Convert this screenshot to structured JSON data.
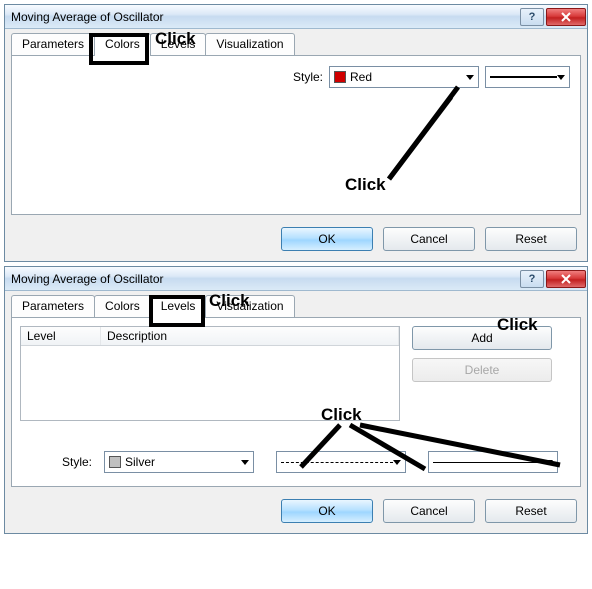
{
  "dialog1": {
    "title": "Moving Average of Oscillator",
    "tabs": [
      "Parameters",
      "Colors",
      "Levels",
      "Visualization"
    ],
    "active_tab": "Colors",
    "style_label": "Style:",
    "color_swatch": "#d00000",
    "color_name": "Red",
    "ok": "OK",
    "cancel": "Cancel",
    "reset": "Reset"
  },
  "dialog2": {
    "title": "Moving Average of Oscillator",
    "tabs": [
      "Parameters",
      "Colors",
      "Levels",
      "Visualization"
    ],
    "active_tab": "Levels",
    "list_cols": {
      "level": "Level",
      "desc": "Description"
    },
    "add": "Add",
    "delete": "Delete",
    "style_label": "Style:",
    "color_swatch": "#c0c0c0",
    "color_name": "Silver",
    "ok": "OK",
    "cancel": "Cancel",
    "reset": "Reset"
  },
  "annotations": {
    "click": "Click"
  }
}
